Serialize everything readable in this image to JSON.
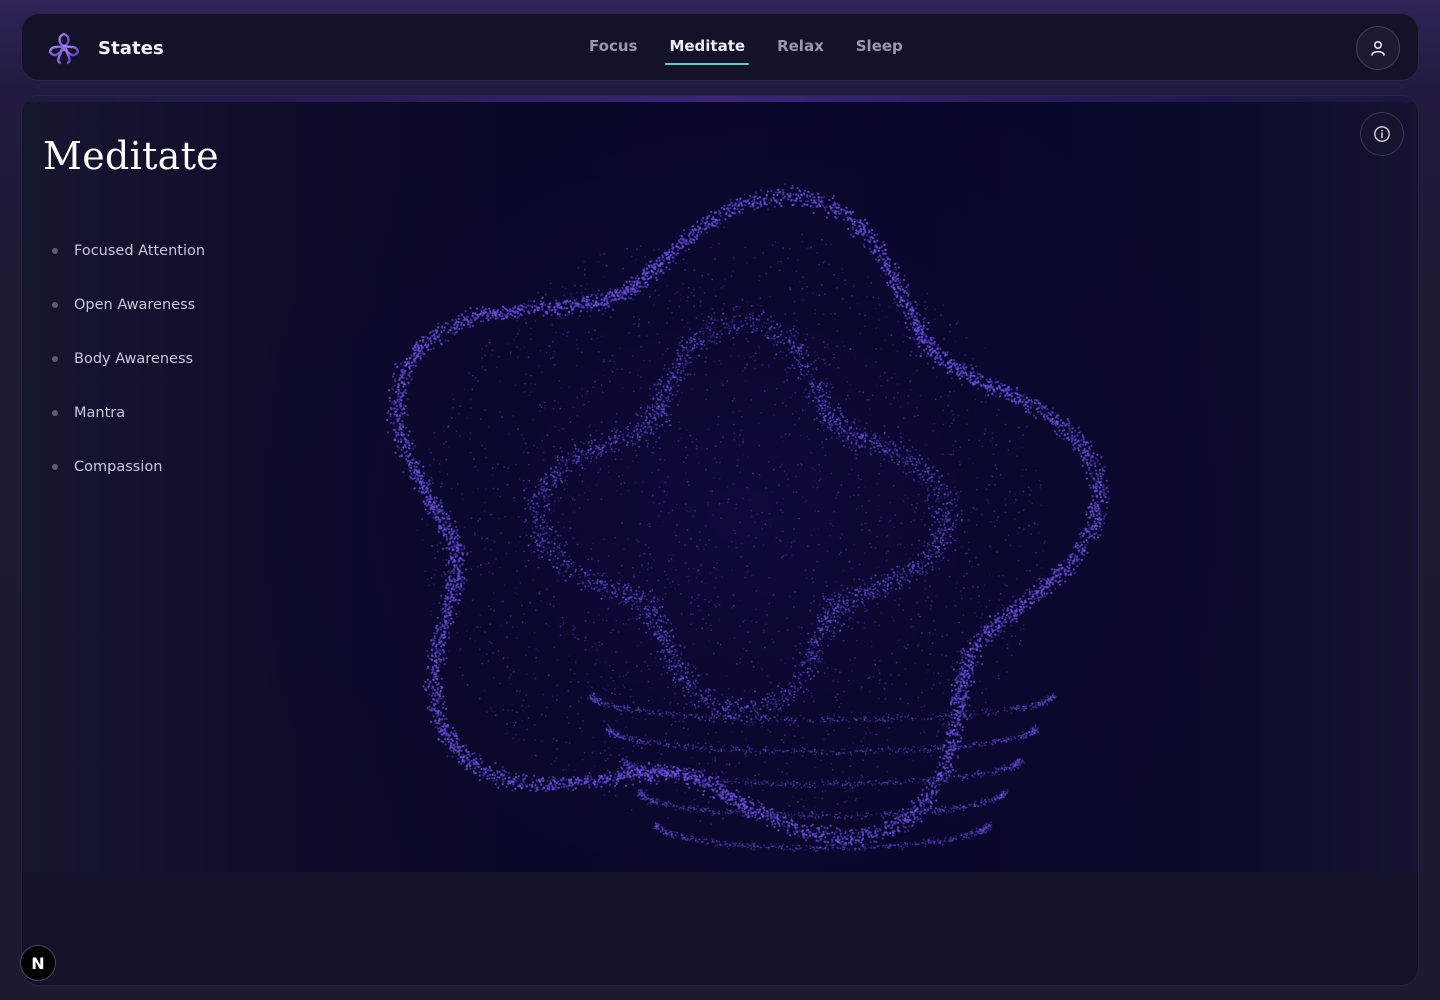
{
  "app": {
    "name": "States",
    "logo_icon": "flower-logo-icon",
    "accent_color": "#5fc8cf",
    "brand_color": "#7b5cd6"
  },
  "nav": {
    "tabs": [
      {
        "label": "Focus",
        "active": false
      },
      {
        "label": "Meditate",
        "active": true
      },
      {
        "label": "Relax",
        "active": false
      },
      {
        "label": "Sleep",
        "active": false
      }
    ]
  },
  "header": {
    "profile_icon": "user-icon"
  },
  "main": {
    "title": "Meditate",
    "info_icon": "info-icon",
    "practices": [
      {
        "label": "Focused Attention"
      },
      {
        "label": "Open Awareness"
      },
      {
        "label": "Body Awareness"
      },
      {
        "label": "Mantra"
      },
      {
        "label": "Compassion"
      }
    ],
    "visualization": {
      "type": "particle-flower",
      "particle_color": "#6a4fe0"
    }
  },
  "badge": {
    "letter": "N"
  }
}
